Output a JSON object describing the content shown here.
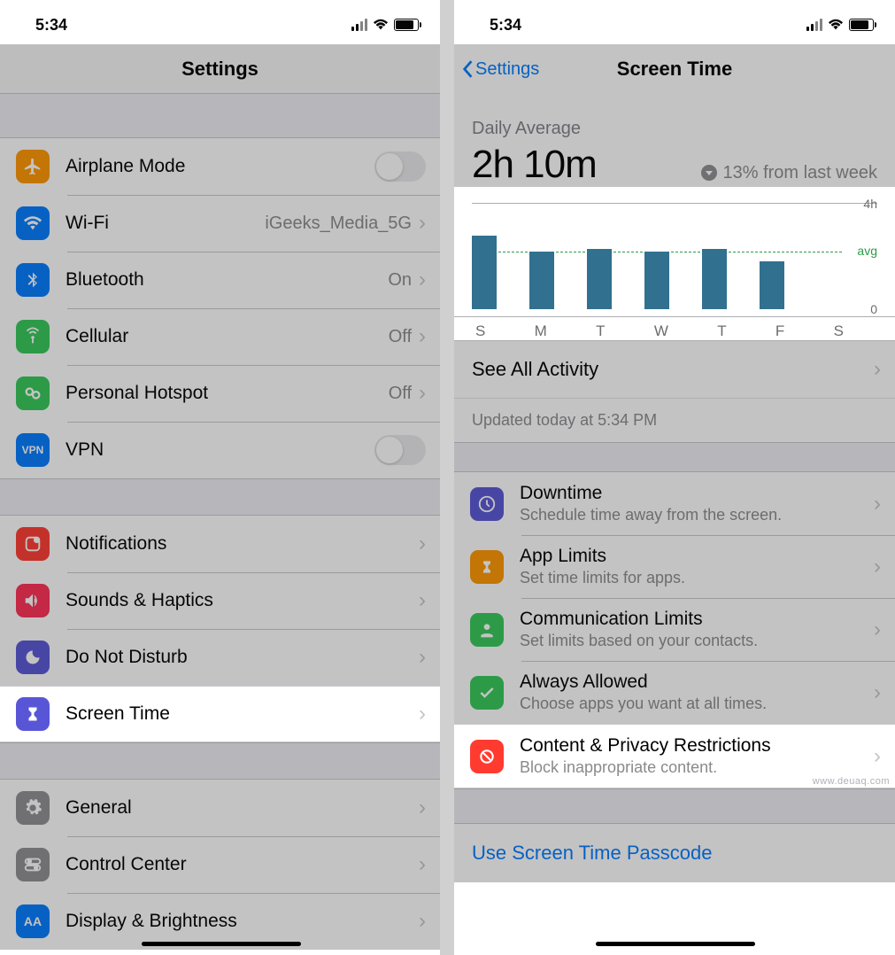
{
  "status": {
    "time": "5:34"
  },
  "left": {
    "title": "Settings",
    "rows": {
      "airplane": {
        "label": "Airplane Mode",
        "color": "#ff9500"
      },
      "wifi": {
        "label": "Wi-Fi",
        "value": "iGeeks_Media_5G",
        "color": "#007aff"
      },
      "bluetooth": {
        "label": "Bluetooth",
        "value": "On",
        "color": "#007aff"
      },
      "cellular": {
        "label": "Cellular",
        "value": "Off",
        "color": "#34c759"
      },
      "hotspot": {
        "label": "Personal Hotspot",
        "value": "Off",
        "color": "#34c759"
      },
      "vpn": {
        "label": "VPN",
        "color": "#007aff"
      },
      "notifications": {
        "label": "Notifications",
        "color": "#ff3b30"
      },
      "sounds": {
        "label": "Sounds & Haptics",
        "color": "#ff2d55"
      },
      "dnd": {
        "label": "Do Not Disturb",
        "color": "#5856d6"
      },
      "screentime": {
        "label": "Screen Time",
        "color": "#5856d6"
      },
      "general": {
        "label": "General",
        "color": "#8e8e93"
      },
      "control": {
        "label": "Control Center",
        "color": "#8e8e93"
      },
      "display": {
        "label": "Display & Brightness",
        "color": "#007aff"
      }
    }
  },
  "right": {
    "back": "Settings",
    "title": "Screen Time",
    "daily_label": "Daily Average",
    "daily_value": "2h 10m",
    "trend": "13% from last week",
    "axis_top": "4h",
    "axis_avg": "avg",
    "axis_zero": "0",
    "see_all": "See All Activity",
    "updated": "Updated today at 5:34 PM",
    "features": {
      "downtime": {
        "title": "Downtime",
        "sub": "Schedule time away from the screen.",
        "color": "#5856d6"
      },
      "applimits": {
        "title": "App Limits",
        "sub": "Set time limits for apps.",
        "color": "#ff9500"
      },
      "commlimits": {
        "title": "Communication Limits",
        "sub": "Set limits based on your contacts.",
        "color": "#34c759"
      },
      "always": {
        "title": "Always Allowed",
        "sub": "Choose apps you want at all times.",
        "color": "#34c759"
      },
      "content": {
        "title": "Content & Privacy Restrictions",
        "sub": "Block inappropriate content.",
        "color": "#ff3b30"
      }
    },
    "passcode": "Use Screen Time Passcode"
  },
  "chart_data": {
    "type": "bar",
    "categories": [
      "S",
      "M",
      "T",
      "W",
      "T",
      "F",
      "S"
    ],
    "values": [
      2.8,
      2.2,
      2.3,
      2.2,
      2.3,
      1.8,
      0
    ],
    "avg_line": 2.2,
    "ylim": [
      0,
      4
    ],
    "ylabel": "",
    "xlabel": "",
    "title": "Daily Average"
  },
  "watermark": "www.deuaq.com"
}
